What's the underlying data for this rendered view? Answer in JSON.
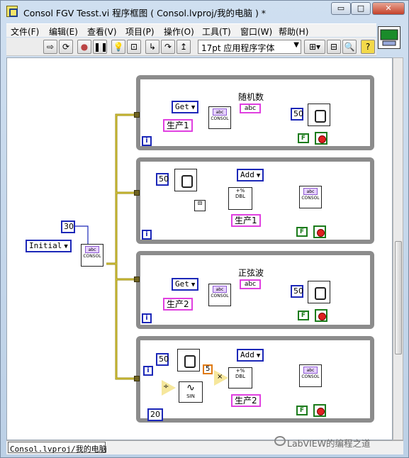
{
  "window": {
    "title": "Consol FGV Tesst.vi 程序框图 ( Consol.lvproj/我的电脑 ) *",
    "min": "▭",
    "max": "□",
    "close": "✕"
  },
  "menu": [
    "文件(F)",
    "编辑(E)",
    "查看(V)",
    "项目(P)",
    "操作(O)",
    "工具(T)",
    "窗口(W)",
    "帮助(H)"
  ],
  "toolbar": {
    "font": "17pt 应用程序字体",
    "help": "?"
  },
  "status": {
    "context": "Consol.lvproj/我的电脑"
  },
  "watermark": "LabVIEW的编程之道",
  "diagram": {
    "left": {
      "const": "30",
      "enum": "Initial",
      "subvi": "CONSOL",
      "abc": "abc"
    },
    "case1": {
      "enum": "Get",
      "label": "随机数",
      "string": "生产1",
      "wait": "50",
      "bool": "F",
      "subvi": "CONSOL",
      "abc": "abc"
    },
    "case2": {
      "wait": "50",
      "enum": "Add",
      "string": "生产1",
      "bool": "F",
      "subvi": "CONSOL",
      "dbl": "DBL"
    },
    "case3": {
      "enum": "Get",
      "label": "正弦波",
      "string": "生产2",
      "wait": "50",
      "bool": "F",
      "subvi": "CONSOL",
      "abc": "abc"
    },
    "case4": {
      "wait": "50",
      "enum": "Add",
      "num5": "5",
      "num20": "20",
      "string": "生产2",
      "bool": "F",
      "subvi": "CONSOL",
      "sin": "SIN",
      "dbl": "DBL"
    },
    "iter": "i"
  }
}
